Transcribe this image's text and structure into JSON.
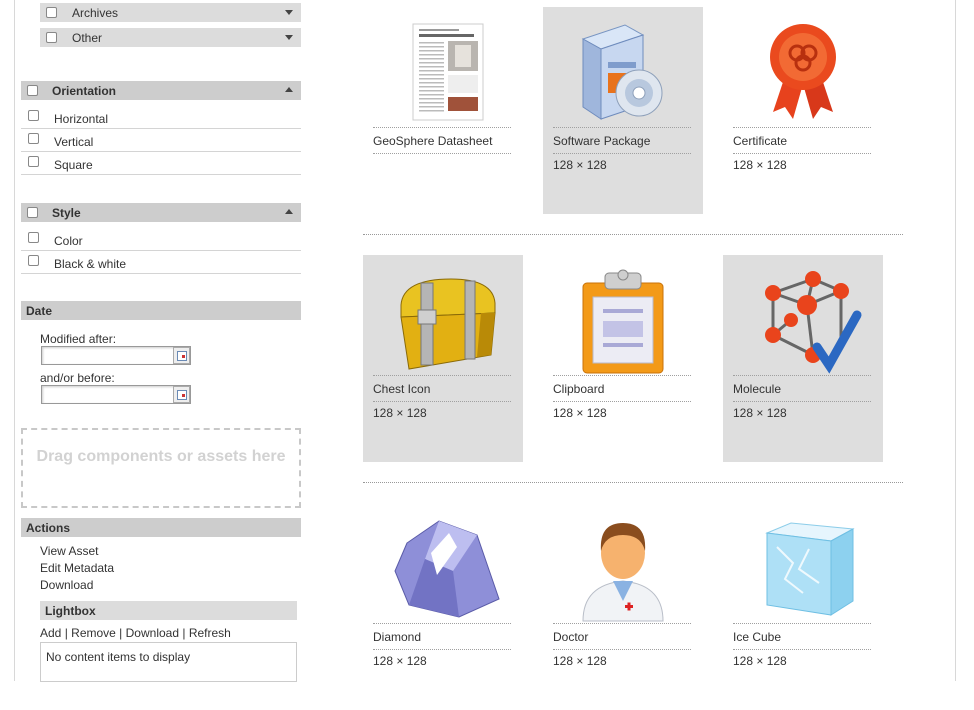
{
  "filters": {
    "type_items": [
      {
        "label": "Archives"
      },
      {
        "label": "Other"
      }
    ],
    "orientation": {
      "title": "Orientation",
      "options": [
        "Horizontal",
        "Vertical",
        "Square"
      ]
    },
    "style": {
      "title": "Style",
      "options": [
        "Color",
        "Black & white"
      ]
    }
  },
  "date": {
    "title": "Date",
    "modified_after_label": "Modified after:",
    "before_label": "and/or before:",
    "after_value": "",
    "before_value": ""
  },
  "dropzone": {
    "text": "Drag components or assets here"
  },
  "actions": {
    "title": "Actions",
    "items": [
      "View Asset",
      "Edit Metadata",
      "Download"
    ]
  },
  "lightbox": {
    "title": "Lightbox",
    "links": [
      "Add",
      "Remove",
      "Download",
      "Refresh"
    ],
    "separator": " | ",
    "empty_text": "No content items to display"
  },
  "assets": [
    {
      "name": "GeoSphere Datasheet",
      "dims": "",
      "icon": "datasheet-icon",
      "selected": false
    },
    {
      "name": "Software Package",
      "dims": "128 × 128",
      "icon": "software-package-icon",
      "selected": true
    },
    {
      "name": "Certificate",
      "dims": "128 × 128",
      "icon": "certificate-icon",
      "selected": false
    },
    {
      "name": "Chest Icon",
      "dims": "128 × 128",
      "icon": "chest-icon",
      "selected": true
    },
    {
      "name": "Clipboard",
      "dims": "128 × 128",
      "icon": "clipboard-icon",
      "selected": false
    },
    {
      "name": "Molecule",
      "dims": "128 × 128",
      "icon": "molecule-icon",
      "selected": true
    },
    {
      "name": "Diamond",
      "dims": "128 × 128",
      "icon": "diamond-icon",
      "selected": false
    },
    {
      "name": "Doctor",
      "dims": "128 × 128",
      "icon": "doctor-icon",
      "selected": false
    },
    {
      "name": "Ice Cube",
      "dims": "128 × 128",
      "icon": "ice-cube-icon",
      "selected": false
    }
  ],
  "colors": {
    "selected_tile": "#dedede",
    "section_header": "#cdcdcd",
    "sub_header": "#dcdcdc"
  }
}
